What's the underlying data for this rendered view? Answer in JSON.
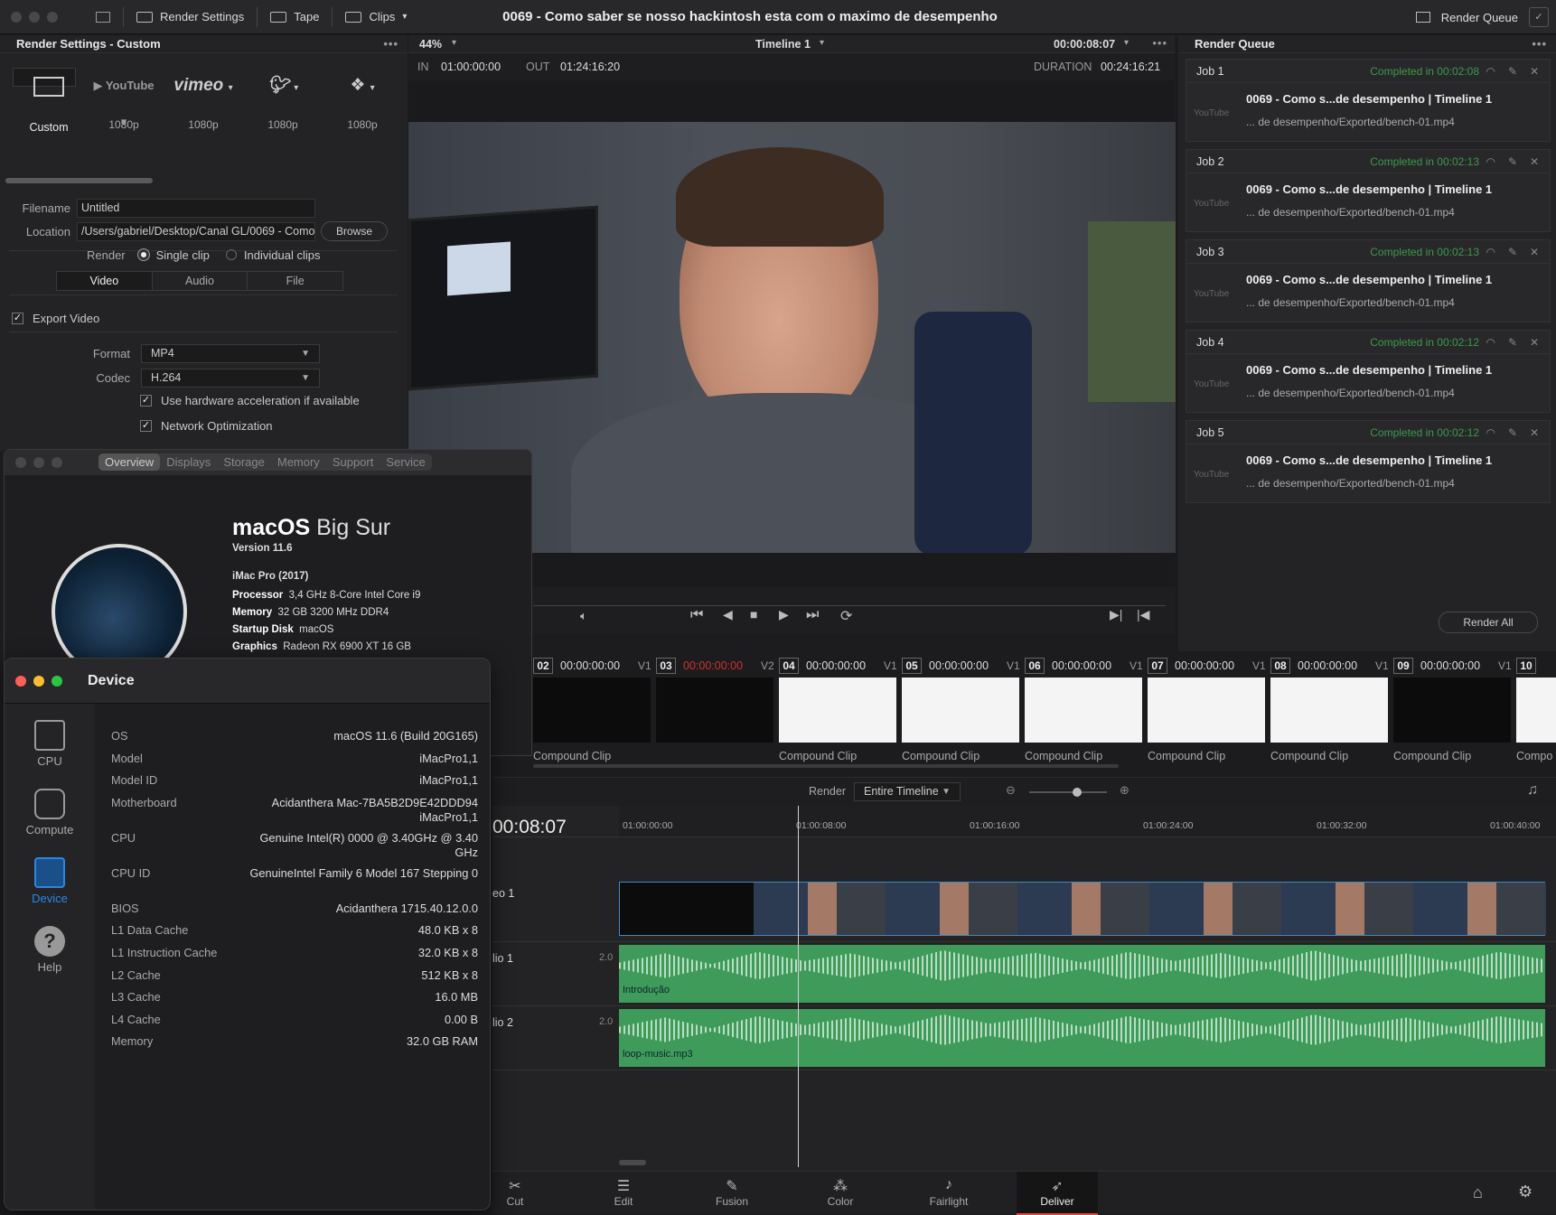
{
  "topbar": {
    "render_settings": "Render Settings",
    "tape": "Tape",
    "clips": "Clips",
    "title": "0069 - Como saber se nosso hackintosh esta com o maximo de desempenho",
    "render_queue": "Render Queue"
  },
  "render_settings": {
    "header": "Render Settings - Custom",
    "presets": [
      {
        "label": "Custom",
        "icon": "film-icon",
        "sub": "Custom"
      },
      {
        "label": "YouTube",
        "sub": "1080p"
      },
      {
        "label": "vimeo",
        "sub": "1080p"
      },
      {
        "label": "twitter",
        "sub": "1080p"
      },
      {
        "label": "dropbox",
        "sub": "1080p"
      }
    ],
    "filename_label": "Filename",
    "filename": "Untitled",
    "location_label": "Location",
    "location": "/Users/gabriel/Desktop/Canal GL/0069 - Como",
    "browse": "Browse",
    "render_label": "Render",
    "single_clip": "Single clip",
    "individual_clips": "Individual clips",
    "tabs": [
      "Video",
      "Audio",
      "File"
    ],
    "export_video": "Export Video",
    "format_label": "Format",
    "format": "MP4",
    "codec_label": "Codec",
    "codec": "H.264",
    "hw_accel": "Use hardware acceleration if available",
    "network_opt": "Network Optimization"
  },
  "viewer": {
    "zoom": "44%",
    "timeline": "Timeline 1",
    "timecode": "00:00:08:07",
    "in_label": "IN",
    "in": "01:00:00:00",
    "out_label": "OUT",
    "out": "01:24:16:20",
    "duration_label": "DURATION",
    "duration": "00:24:16:21"
  },
  "render_queue": {
    "header": "Render Queue",
    "jobs": [
      {
        "name": "Job 1",
        "status": "Completed in 00:02:08",
        "title": "0069 - Como s...de desempenho | Timeline 1",
        "path": "... de desempenho/Exported/bench-01.mp4"
      },
      {
        "name": "Job 2",
        "status": "Completed in 00:02:13",
        "title": "0069 - Como s...de desempenho | Timeline 1",
        "path": "... de desempenho/Exported/bench-01.mp4"
      },
      {
        "name": "Job 3",
        "status": "Completed in 00:02:13",
        "title": "0069 - Como s...de desempenho | Timeline 1",
        "path": "... de desempenho/Exported/bench-01.mp4"
      },
      {
        "name": "Job 4",
        "status": "Completed in 00:02:12",
        "title": "0069 - Como s...de desempenho | Timeline 1",
        "path": "... de desempenho/Exported/bench-01.mp4"
      },
      {
        "name": "Job 5",
        "status": "Completed in 00:02:12",
        "title": "0069 - Como s...de desempenho | Timeline 1",
        "path": "... de desempenho/Exported/bench-01.mp4"
      }
    ],
    "yt": "YouTube",
    "render_all": "Render All"
  },
  "clips": [
    {
      "num": "02",
      "tc": "00:00:00:00",
      "track": "V1",
      "name": "Compound Clip",
      "white": false
    },
    {
      "num": "03",
      "tc": "00:00:00:00",
      "track": "V2",
      "name": "",
      "white": false,
      "red": true
    },
    {
      "num": "04",
      "tc": "00:00:00:00",
      "track": "V1",
      "name": "Compound Clip",
      "white": true
    },
    {
      "num": "05",
      "tc": "00:00:00:00",
      "track": "V1",
      "name": "Compound Clip",
      "white": true
    },
    {
      "num": "06",
      "tc": "00:00:00:00",
      "track": "V1",
      "name": "Compound Clip",
      "white": true
    },
    {
      "num": "07",
      "tc": "00:00:00:00",
      "track": "V1",
      "name": "Compound Clip",
      "white": true
    },
    {
      "num": "08",
      "tc": "00:00:00:00",
      "track": "V1",
      "name": "Compound Clip",
      "white": true
    },
    {
      "num": "09",
      "tc": "00:00:00:00",
      "track": "V1",
      "name": "Compound Clip",
      "white": false
    },
    {
      "num": "10",
      "tc": "",
      "track": "",
      "name": "Compo",
      "white": true
    }
  ],
  "timeline": {
    "render_label": "Render",
    "render_mode": "Entire Timeline",
    "timecode": "00:08:07",
    "ticks": [
      "01:00:00:00",
      "01:00:08:00",
      "01:00:16:00",
      "01:00:24:00",
      "01:00:32:00",
      "01:00:40:00"
    ],
    "video_track": "eo 1",
    "audio1": "lio 1",
    "audio2": "lio 2",
    "level": "2.0",
    "clip_a1": "Introdução",
    "clip_a2": "loop-music.mp3"
  },
  "pages": [
    "Cut",
    "Edit",
    "Fusion",
    "Color",
    "Fairlight",
    "Deliver"
  ],
  "about": {
    "tabs": [
      "Overview",
      "Displays",
      "Storage",
      "Memory",
      "Support",
      "Service"
    ],
    "os_bold": "macOS",
    "os_name": "Big Sur",
    "version": "Version 11.6",
    "model": "iMac Pro (2017)",
    "specs": [
      {
        "k": "Processor",
        "v": "3,4 GHz 8-Core Intel Core i9"
      },
      {
        "k": "Memory",
        "v": "32 GB 3200 MHz DDR4"
      },
      {
        "k": "Startup Disk",
        "v": "macOS"
      },
      {
        "k": "Graphics",
        "v": "Radeon RX 6900 XT 16 GB"
      }
    ]
  },
  "device": {
    "title": "Device",
    "sidebar": [
      "CPU",
      "Compute",
      "Device",
      "Help"
    ],
    "rows": [
      {
        "k": "OS",
        "v": "macOS 11.6 (Build 20G165)"
      },
      {
        "k": "Model",
        "v": "iMacPro1,1"
      },
      {
        "k": "Model ID",
        "v": "iMacPro1,1"
      },
      {
        "k": "Motherboard",
        "v": "Acidanthera Mac-7BA5B2D9E42DDD94 iMacPro1,1"
      },
      {
        "k": "CPU",
        "v": "Genuine Intel(R) 0000 @ 3.40GHz @ 3.40 GHz"
      },
      {
        "k": "CPU ID",
        "v": "GenuineIntel Family 6 Model 167 Stepping 0"
      },
      {
        "k": "BIOS",
        "v": "Acidanthera 1715.40.12.0.0"
      },
      {
        "k": "L1 Data Cache",
        "v": "48.0 KB x 8"
      },
      {
        "k": "L1 Instruction Cache",
        "v": "32.0 KB x 8"
      },
      {
        "k": "L2 Cache",
        "v": "512 KB x 8"
      },
      {
        "k": "L3 Cache",
        "v": "16.0 MB"
      },
      {
        "k": "L4 Cache",
        "v": "0.00 B"
      },
      {
        "k": "Memory",
        "v": "32.0 GB RAM"
      }
    ]
  }
}
